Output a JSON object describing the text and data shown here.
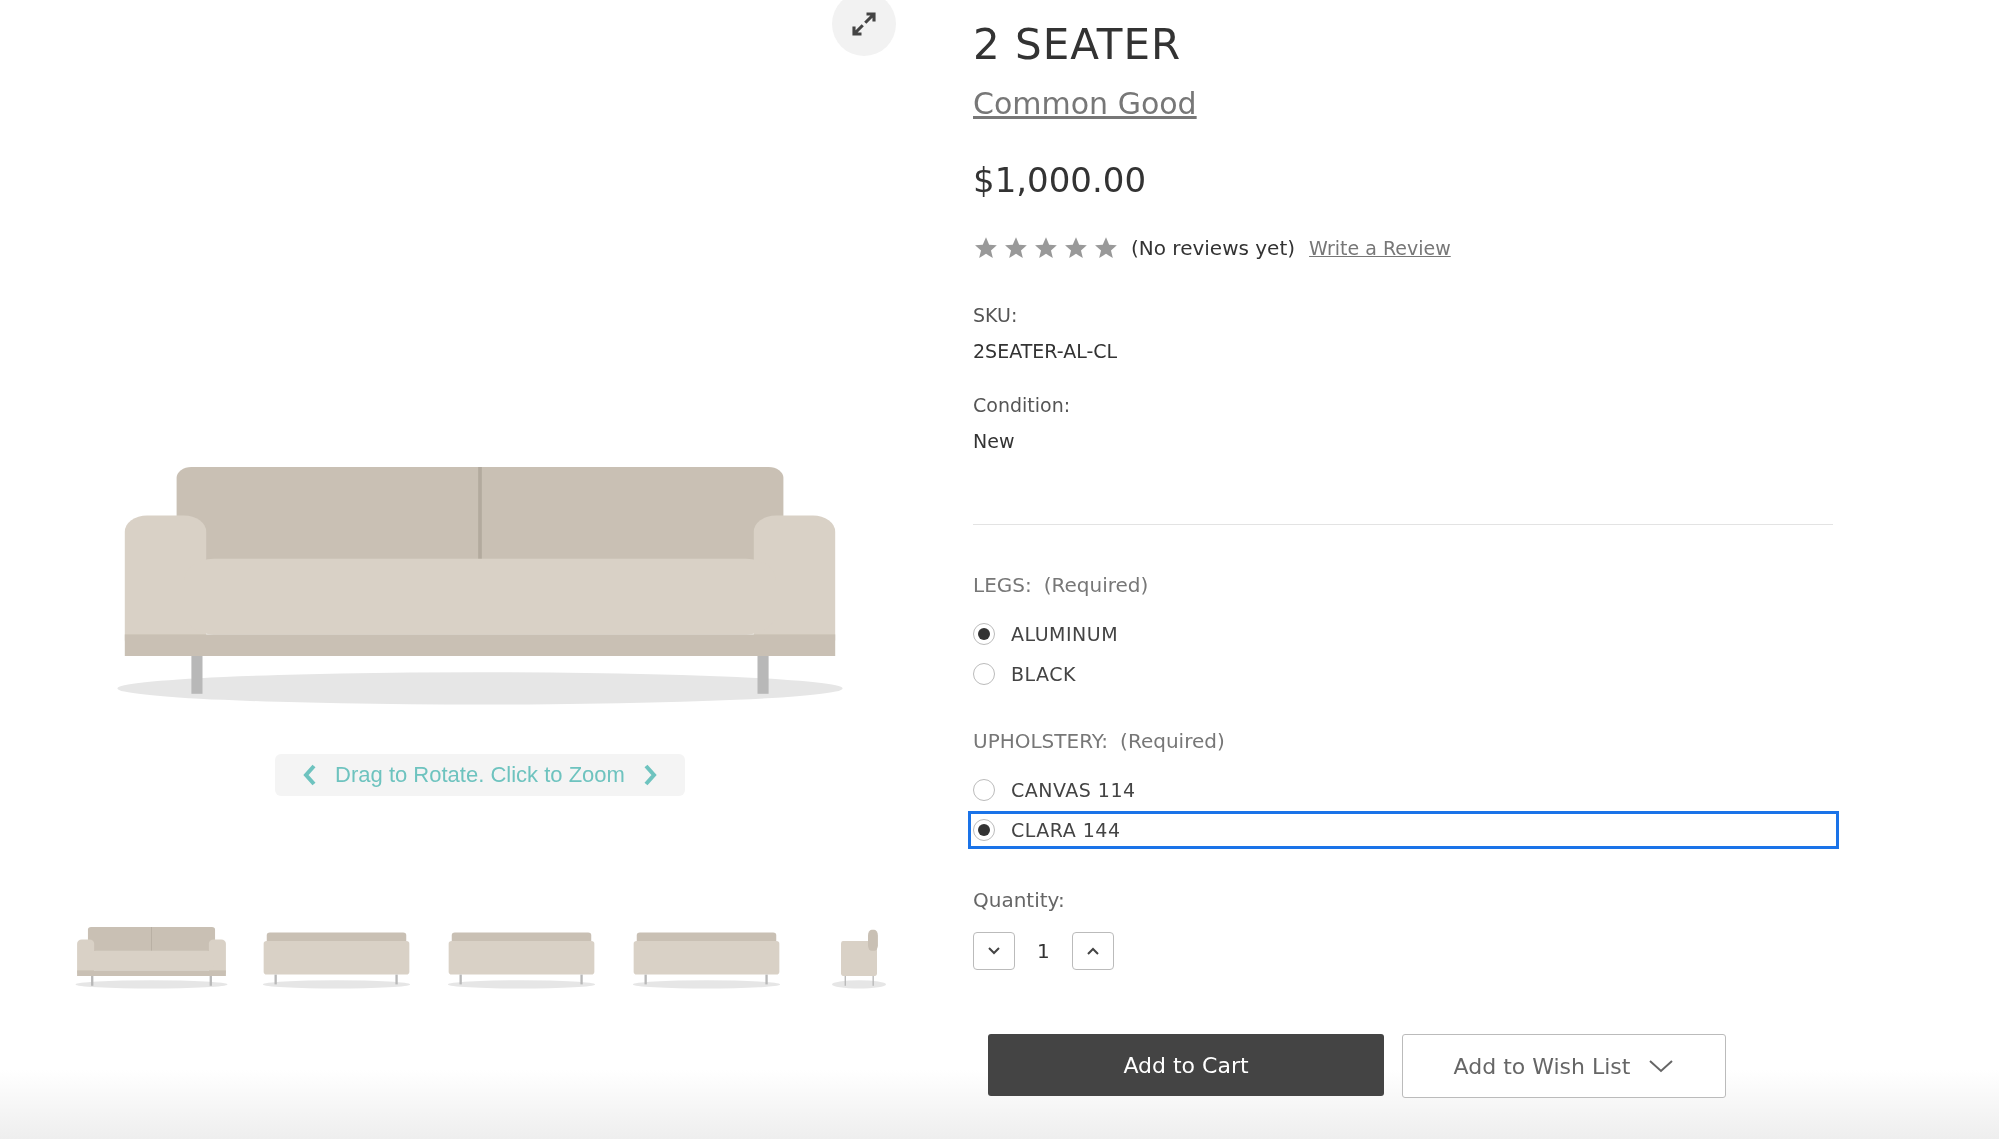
{
  "gallery": {
    "hint": "Drag to Rotate. Click to Zoom",
    "thumbnails": [
      {
        "kind": "front"
      },
      {
        "kind": "angle"
      },
      {
        "kind": "back"
      },
      {
        "kind": "back"
      },
      {
        "kind": "side"
      }
    ]
  },
  "product": {
    "title": "2 SEATER",
    "brand": "Common Good",
    "price": "$1,000.00",
    "rating": {
      "summary": "(No reviews yet)",
      "write_link": "Write a Review"
    },
    "details": [
      {
        "label": "SKU:",
        "value": "2SEATER-AL-CL"
      },
      {
        "label": "Condition:",
        "value": "New"
      }
    ]
  },
  "options": [
    {
      "label": "LEGS:",
      "note": "(Required)",
      "choices": [
        {
          "label": "ALUMINUM",
          "selected": true,
          "focused": false
        },
        {
          "label": "BLACK",
          "selected": false,
          "focused": false
        }
      ]
    },
    {
      "label": "UPHOLSTERY:",
      "note": "(Required)",
      "choices": [
        {
          "label": "CANVAS 114",
          "selected": false,
          "focused": false
        },
        {
          "label": "CLARA 144",
          "selected": true,
          "focused": true
        }
      ]
    }
  ],
  "quantity": {
    "label": "Quantity:",
    "value": "1"
  },
  "buttons": {
    "add_to_cart": "Add to Cart",
    "wish_list": "Add to Wish List"
  }
}
